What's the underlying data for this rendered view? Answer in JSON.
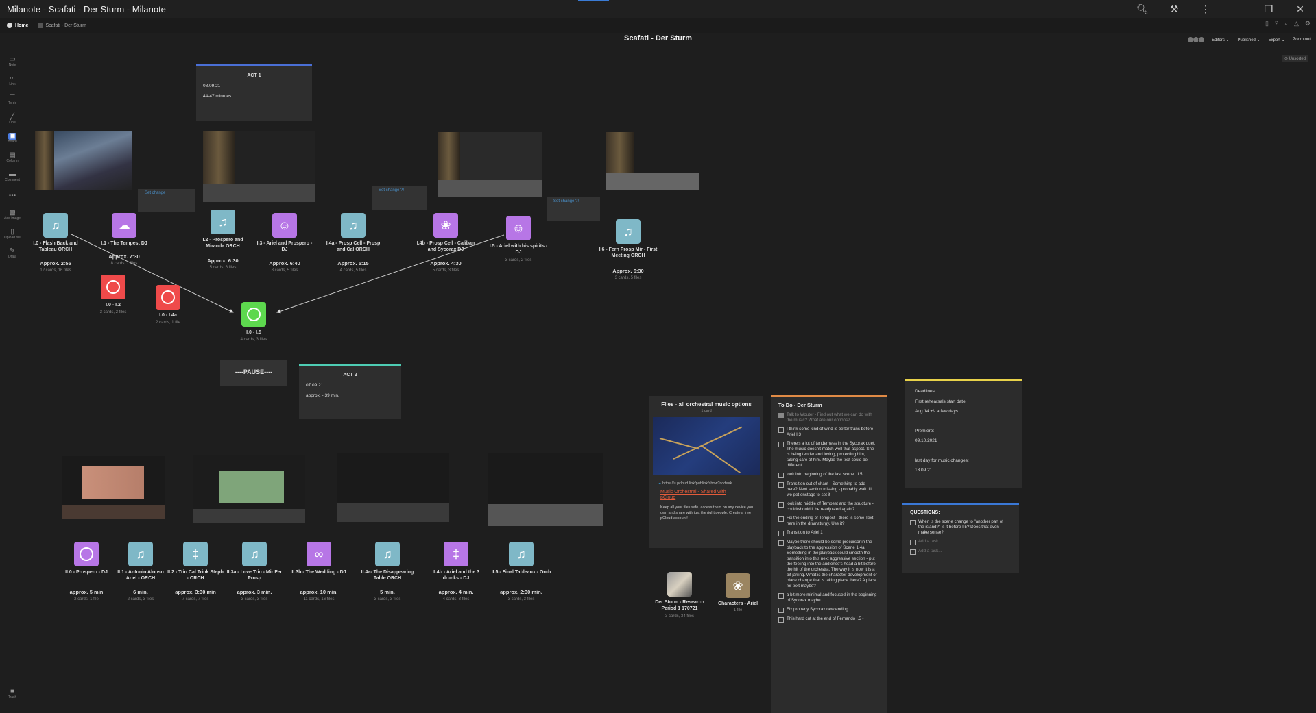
{
  "window": {
    "title": "Milanote - Scafati - Der Sturm - Milanote"
  },
  "breadcrumb": {
    "home": "Home",
    "board": "Scafati - Der Sturm"
  },
  "board_title": "Scafati - Der Sturm",
  "toolbar": {
    "editors": "Editors",
    "published": "Published",
    "export": "Export",
    "zoom": "Zoom out"
  },
  "unsorted": "Unsorted",
  "sidebar": [
    "Note",
    "Link",
    "To-do",
    "Line",
    "Board",
    "Column",
    "Comment",
    "•••",
    "Add image",
    "Upload file",
    "Draw"
  ],
  "trash": "Trash",
  "act1": {
    "title": "ACT 1",
    "date": "08.09.21",
    "duration": "44-47 minutes"
  },
  "act2": {
    "title": "ACT 2",
    "date": "07.09.21",
    "duration": "approx. -   39 min."
  },
  "pause": "----PAUSE----",
  "set_changes": [
    "Set change",
    "Set change ?!",
    "Set change ?!"
  ],
  "act1_cards": [
    {
      "label": "I.0 - Flash Back and Tableau ORCH",
      "approx": "Approx. 2:55",
      "sub": "12 cards, 16 files"
    },
    {
      "label": "I.1 - The Tempest DJ",
      "approx": "Approx. 7:30",
      "sub": "8 cards, 7 files"
    },
    {
      "label": "I.2 - Prospero and Miranda ORCH",
      "approx": "Approx. 6:30",
      "sub": "5 cards, 6 files"
    },
    {
      "label": "I.3 - Ariel and Prospero - DJ",
      "approx": "Approx. 6:40",
      "sub": "8 cards, 5 files"
    },
    {
      "label": "I.4a - Prosp Cell - Prosp and Cal ORCH",
      "approx": "Approx. 5:15",
      "sub": "4 cards, 5 files"
    },
    {
      "label": "I.4b - Prosp Cell - Caliban and Sycorax DJ",
      "approx": "Approx. 4:30",
      "sub": "5 cards, 3 files"
    },
    {
      "label": "I.5 - Ariel with his spirits - DJ",
      "approx": "",
      "sub": "3 cards, 2 files"
    },
    {
      "label": "I.6 - Fern Prosp Mir - First Meeting ORCH",
      "approx": "Approx. 6:30",
      "sub": "3 cards, 5 files"
    }
  ],
  "link_cards": [
    {
      "label": "I.0 - I.2",
      "sub": "3 cards, 2 files"
    },
    {
      "label": "I.0 - I.4a",
      "sub": "2 cards, 1 file"
    },
    {
      "label": "I.0 - I.5",
      "sub": "4 cards, 3 files"
    }
  ],
  "act2_cards": [
    {
      "label": "II.0 - Prospero - DJ",
      "approx": "approx. 5 min",
      "sub": "2 cards, 1 file"
    },
    {
      "label": "II.1 - Antonio Alonso Ariel - ORCH",
      "approx": "6 min.",
      "sub": "2 cards, 3 files"
    },
    {
      "label": "II.2 - Trio Cal Trink Steph - ORCH",
      "approx": "approx. 3:30 min",
      "sub": "7 cards, 7 files"
    },
    {
      "label": "II.3a - Love Trio - Mir Fer Prosp",
      "approx": "approx. 3 min.",
      "sub": "3 cards, 3 files"
    },
    {
      "label": "II.3b - The Wedding - DJ",
      "approx": "approx. 10 min.",
      "sub": "11 cards, 16 files"
    },
    {
      "label": "II.4a- The Disappearing Table ORCH",
      "approx": "5 min.",
      "sub": "3 cards, 3 files"
    },
    {
      "label": "II.4b - Ariel and the 3 drunks - DJ",
      "approx": "approx. 4 min.",
      "sub": "4 cards, 3 files"
    },
    {
      "label": "II.5 - Final Tableaux - Orch",
      "approx": "approx. 2:30 min.",
      "sub": "3 cards, 3 files"
    }
  ],
  "files_card": {
    "title": "Files - all orchestral music options",
    "sub": "1 card",
    "url": "https://u.pcloud.link/publink/show?code=k",
    "link": "Music Orchestral - Shared with pCloud",
    "desc": "Keep all your files safe, access them on any device you own and share with just the right people. Create a free pCloud account!"
  },
  "research": {
    "label": "Der Sturm - Research Period 1 170721",
    "sub": "3 cards, 34 files"
  },
  "characters": {
    "label": "Characters - Ariel",
    "sub": "1 file"
  },
  "todo": {
    "title": "To Do - Der Sturm",
    "items": [
      {
        "text": "Talk to Wouter - Find out what we can do with the music? What are our options?",
        "done": true
      },
      {
        "text": "I think some kind of wind is better trans before Ariel I.3",
        "done": false
      },
      {
        "text": "There's a lot of tenderness in the Sycorax duet. The music doesn't match well that aspect. She is being tender and loving, protecting him, taking care of him. Maybe the text could be different.",
        "done": false
      },
      {
        "text": "look into beginning of the last scene. II.5",
        "done": false
      },
      {
        "text": "Transition out of chant - Something to add here? Next section missing - probably wait till we get onstage to set it",
        "done": false
      },
      {
        "text": " look into middle of Tempest and the structure - could/should it be readjusted again?",
        "done": false
      },
      {
        "text": "Fix the ending of Tempest - there is some Text here in the dramaturgy. Use it?",
        "done": false
      },
      {
        "text": "Transition to Ariel 1",
        "done": false
      },
      {
        "text": "Maybe there should be some precursor in the playback to the aggression of Scene 1.4a. Something in the playback could smooth the transition into this next aggressive section - put the feeling into the audience's head a bit before the hit of the orchestra. The way it is now it is a bit jarring. What is the character development or place change that is taking place there? A place for text maybe?",
        "done": false
      },
      {
        "text": "a bit more minimal and focused in the beginning of Sycorax maybe",
        "done": false
      },
      {
        "text": "Fix properly Sycorax new ending",
        "done": false
      },
      {
        "text": "This hard cut at the end of Fernando I.5 -",
        "done": false
      }
    ]
  },
  "deadlines": {
    "title": "Deadlines:",
    "rehearsal_label": "First rehearsals start date:",
    "rehearsal": "Aug 14 +/- a few days",
    "premiere_label": "Premiere:",
    "premiere": "09.10.2021",
    "music_label": "last day for music changes:",
    "music": "13.09.21"
  },
  "questions": {
    "title": "QUESTIONS:",
    "items": [
      "When is the scene change to \"another part of the island?\" is it before I.5? Does that even make sense?"
    ],
    "placeholders": [
      "Add a task...",
      "Add a task..."
    ]
  }
}
